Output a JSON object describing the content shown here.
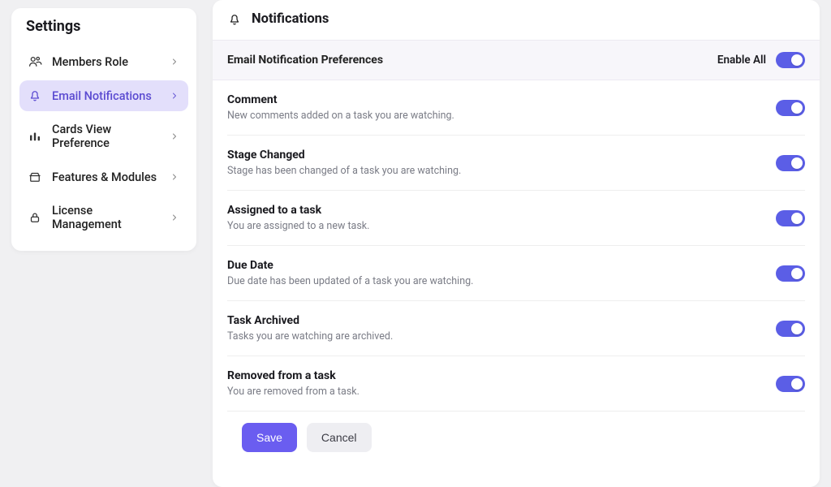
{
  "colors": {
    "accent": "#6a5df0",
    "accent_soft": "#e3dffb",
    "toggle_on": "#5b5ee6"
  },
  "sidebar": {
    "title": "Settings",
    "items": [
      {
        "label": "Members Role",
        "icon": "members-icon",
        "active": false
      },
      {
        "label": "Email Notifications",
        "icon": "bell-icon",
        "active": true
      },
      {
        "label": "Cards View Preference",
        "icon": "bars-icon",
        "active": false
      },
      {
        "label": "Features & Modules",
        "icon": "modules-icon",
        "active": false
      },
      {
        "label": "License Management",
        "icon": "lock-icon",
        "active": false
      }
    ]
  },
  "panel": {
    "title": "Notifications",
    "section_title": "Email Notification Preferences",
    "enable_all_label": "Enable All",
    "enable_all_on": true,
    "prefs": [
      {
        "title": "Comment",
        "desc": "New comments added on a task you are watching.",
        "on": true
      },
      {
        "title": "Stage Changed",
        "desc": "Stage has been changed of a task you are watching.",
        "on": true
      },
      {
        "title": "Assigned to a task",
        "desc": "You are assigned to a new task.",
        "on": true
      },
      {
        "title": "Due Date",
        "desc": "Due date has been updated of a task you are watching.",
        "on": true
      },
      {
        "title": "Task Archived",
        "desc": "Tasks you are watching are archived.",
        "on": true
      },
      {
        "title": "Removed from a task",
        "desc": "You are removed from a task.",
        "on": true
      }
    ],
    "save_label": "Save",
    "cancel_label": "Cancel"
  }
}
